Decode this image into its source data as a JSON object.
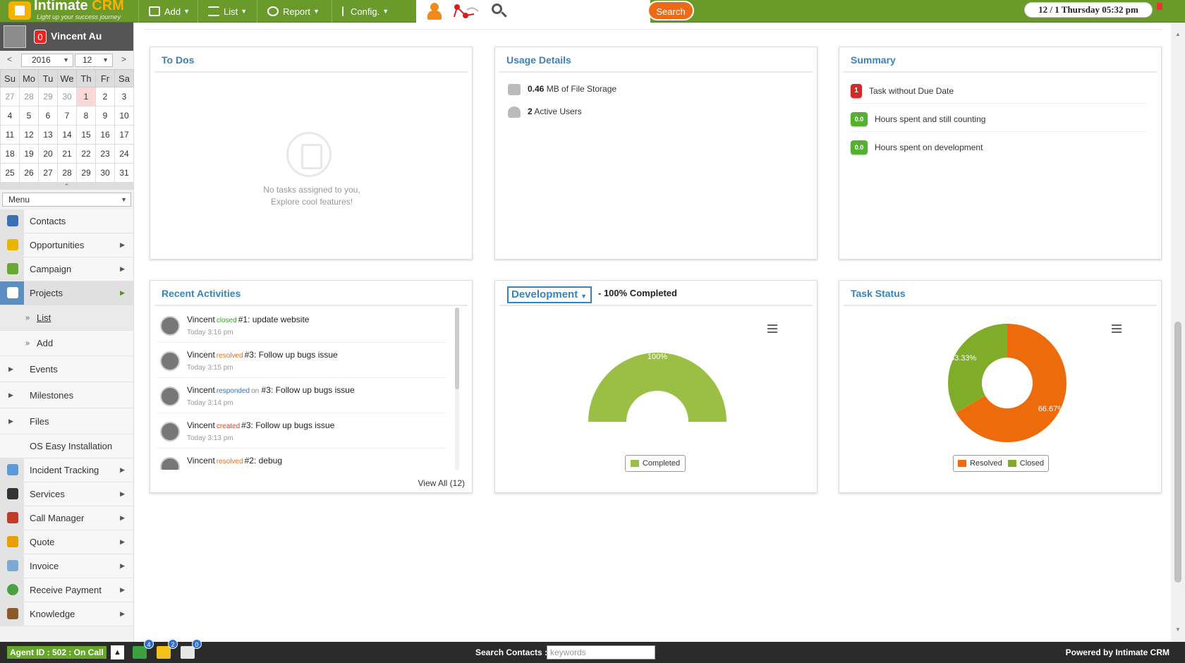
{
  "brand": {
    "name": "Intimate",
    "name_accent": "CRM",
    "tagline": "Light up your success journey"
  },
  "topnav": [
    {
      "label": "Add",
      "icon": "edit-icon"
    },
    {
      "label": "List",
      "icon": "list-icon"
    },
    {
      "label": "Report",
      "icon": "report-icon"
    },
    {
      "label": "Config.",
      "icon": "info-icon"
    }
  ],
  "search_button": "Search",
  "datetime": "12 / 1  Thursday  05:32 pm",
  "user": {
    "name": "Vincent Au",
    "notifications": "0"
  },
  "calendar": {
    "year": "2016",
    "month": "12",
    "prev": "<",
    "next": ">",
    "weekdays": [
      "Su",
      "Mo",
      "Tu",
      "We",
      "Th",
      "Fr",
      "Sa"
    ],
    "weeks": [
      [
        "27",
        "28",
        "29",
        "30",
        "1",
        "2",
        "3"
      ],
      [
        "4",
        "5",
        "6",
        "7",
        "8",
        "9",
        "10"
      ],
      [
        "11",
        "12",
        "13",
        "14",
        "15",
        "16",
        "17"
      ],
      [
        "18",
        "19",
        "20",
        "21",
        "22",
        "23",
        "24"
      ],
      [
        "25",
        "26",
        "27",
        "28",
        "29",
        "30",
        "31"
      ]
    ]
  },
  "menu_select": "Menu",
  "nav": {
    "contacts": "Contacts",
    "opportunities": "Opportunities",
    "campaign": "Campaign",
    "projects": "Projects",
    "list": "List",
    "add": "Add",
    "events": "Events",
    "milestones": "Milestones",
    "files": "Files",
    "os_easy": "OS Easy Installation",
    "incident": "Incident Tracking",
    "services": "Services",
    "call_manager": "Call Manager",
    "quote": "Quote",
    "invoice": "Invoice",
    "receive_payment": "Receive Payment",
    "knowledge": "Knowledge"
  },
  "todos": {
    "title": "To Dos",
    "empty_text": "No tasks assigned to you, Explore cool features!"
  },
  "usage": {
    "title": "Usage Details",
    "storage_value": "0.46",
    "storage_text": "MB of File Storage",
    "users_value": "2",
    "users_text": "Active Users"
  },
  "summary": {
    "title": "Summary",
    "rows": [
      {
        "badge": "1",
        "text": "Task without Due Date",
        "color": "#d02a2a"
      },
      {
        "badge": "0.0",
        "text": "Hours spent and still counting",
        "color": "#55b032"
      },
      {
        "badge": "0.0",
        "text": "Hours spent on development",
        "color": "#55b032"
      }
    ]
  },
  "recent": {
    "title": "Recent Activities",
    "view_all": "View All (12)",
    "items": [
      {
        "user": "Vincent",
        "verb": "closed",
        "on": "",
        "text": "#1: update website",
        "time": "Today 3:16 pm"
      },
      {
        "user": "Vincent",
        "verb": "resolved",
        "on": "",
        "text": "#3: Follow up bugs issue",
        "time": "Today 3:15 pm"
      },
      {
        "user": "Vincent",
        "verb": "responded",
        "on": "on",
        "text": "#3: Follow up bugs issue",
        "time": "Today 3:14 pm"
      },
      {
        "user": "Vincent",
        "verb": "created",
        "on": "",
        "text": "#3: Follow up bugs issue",
        "time": "Today 3:13 pm"
      },
      {
        "user": "Vincent",
        "verb": "resolved",
        "on": "",
        "text": "#2: debug",
        "time": ""
      }
    ]
  },
  "development": {
    "select": "Development",
    "completed_text": "- 100% Completed"
  },
  "task_status": {
    "title": "Task Status"
  },
  "chart_data": [
    {
      "type": "pie",
      "variant": "semi-donut",
      "categories": [
        "Completed"
      ],
      "values": [
        100
      ],
      "labels": [
        "100%"
      ],
      "colors": [
        "#9bbf45"
      ],
      "legend": "bottom"
    },
    {
      "type": "pie",
      "variant": "donut",
      "categories": [
        "Resolved",
        "Closed"
      ],
      "values": [
        66.67,
        33.33
      ],
      "labels": [
        "66.67%",
        "33.33%"
      ],
      "colors": [
        "#ed6b0b",
        "#7fad2a"
      ],
      "legend": "bottom"
    }
  ],
  "bottombar": {
    "agent": "Agent ID : 502 : On Call",
    "upload": "▲",
    "badges": [
      "4",
      "2",
      "0"
    ],
    "search_label": "Search Contacts :",
    "search_placeholder": "keywords",
    "powered": "Powered by Intimate CRM"
  }
}
